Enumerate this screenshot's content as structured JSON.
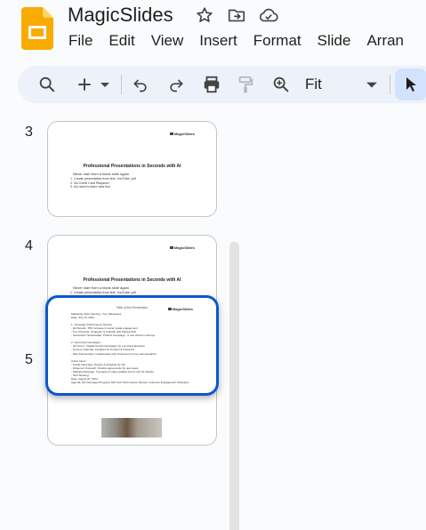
{
  "app": {
    "title": "MagicSlides",
    "brand_color": "#f9ab00"
  },
  "menu": {
    "items": [
      "File",
      "Edit",
      "View",
      "Insert",
      "Format",
      "Slide",
      "Arran"
    ]
  },
  "toolbar": {
    "zoom_value": "Fit",
    "icons": [
      "search-icon",
      "add-icon",
      "dropdown-arrow-icon",
      "undo-icon",
      "redo-icon",
      "print-icon",
      "paint-format-icon",
      "zoom-icon",
      "zoom-dropdown-icon",
      "select-cursor-icon"
    ]
  },
  "filmstrip": {
    "slide3": {
      "number": "3",
      "logo": "MagicSlides",
      "title": "Professional Presentations in Seconds with AI",
      "subtitle": "Never start from a blank slide again",
      "items": [
        "1. Create presentation from text, YouTube, pdf",
        "2. No Credit Card Required",
        "3. No need to learn new tool"
      ]
    },
    "slide4": {
      "number": "4",
      "logo": "MagicSlides",
      "title": "Professional Presentations in Seconds with AI",
      "subtitle": "Never start from a blank slide again",
      "items": [
        "1. Create presentation from text, YouTube, pdf"
      ]
    },
    "slide5": {
      "number": "5",
      "logo": "MagicSlides",
      "title": "Slide of this Presentation",
      "lines": [
        "Marketing Team Meeting - Key Takeaways",
        "Date: July 15, 2024",
        "",
        "1. Campaign Performance Review:",
        "- Q2 Results: 15% increase in social media engagement",
        "- Top Channels: Instagram & LinkedIn with highest ROI",
        "- Successful \"Sustainable\" Product Campaign - 5 new clients in Europe",
        "",
        "2. Upcoming Campaigns:",
        "- Q3 Focus: \"Digital Growth Campaign\" for our brand launches",
        "- Content Calendar: Finalized for Product & Channels",
        "- New Partnerships: Collaborating with influencers for key demographics",
        "",
        "Action Items:",
        "- Social Campaign: Design & schedule for Q3",
        "- Influencer Outreach: Finalize agreements by next week",
        "- Website Redesign: Complete & make updates live by Oct 31 (Sarah)",
        "- Next Meeting:",
        "Date: August 20, 2024",
        "Agenda: Q3 Campaign Progress, Mid-Year Performance Review, Customer Engagement Strategies"
      ]
    }
  }
}
